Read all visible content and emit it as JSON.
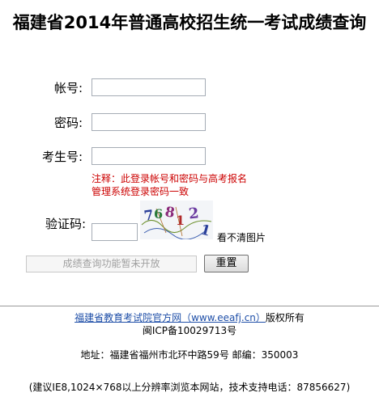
{
  "title": "福建省2014年普通高校招生统一考试成绩查询",
  "form": {
    "account_label": "帐号:",
    "account_value": "",
    "password_label": "密码:",
    "password_value": "",
    "exam_number_label": "考生号:",
    "exam_number_value": "",
    "note_line1": "注释：此登录帐号和密码与高考报名",
    "note_line2": "管理系统登录密码一致",
    "captcha_label": "验证码:",
    "captcha_value": "",
    "captcha_text": "76 8 1 2 1",
    "captcha_refresh": "看不清图片",
    "submit_label": "成绩查询功能暂未开放",
    "reset_label": "重置"
  },
  "footer": {
    "site_link": "福建省教育考试院官方网（www.eeafj.cn）",
    "rights": "版权所有",
    "icp": "闽ICP备10029713号",
    "address": "地址：福建省福州市北环中路59号  邮编：350003",
    "support": "(建议IE8,1024×768以上分辨率浏览本网站，技术支持电话：87856627)"
  },
  "colors": {
    "note": "#cc0000",
    "link": "#1f4fa8"
  }
}
